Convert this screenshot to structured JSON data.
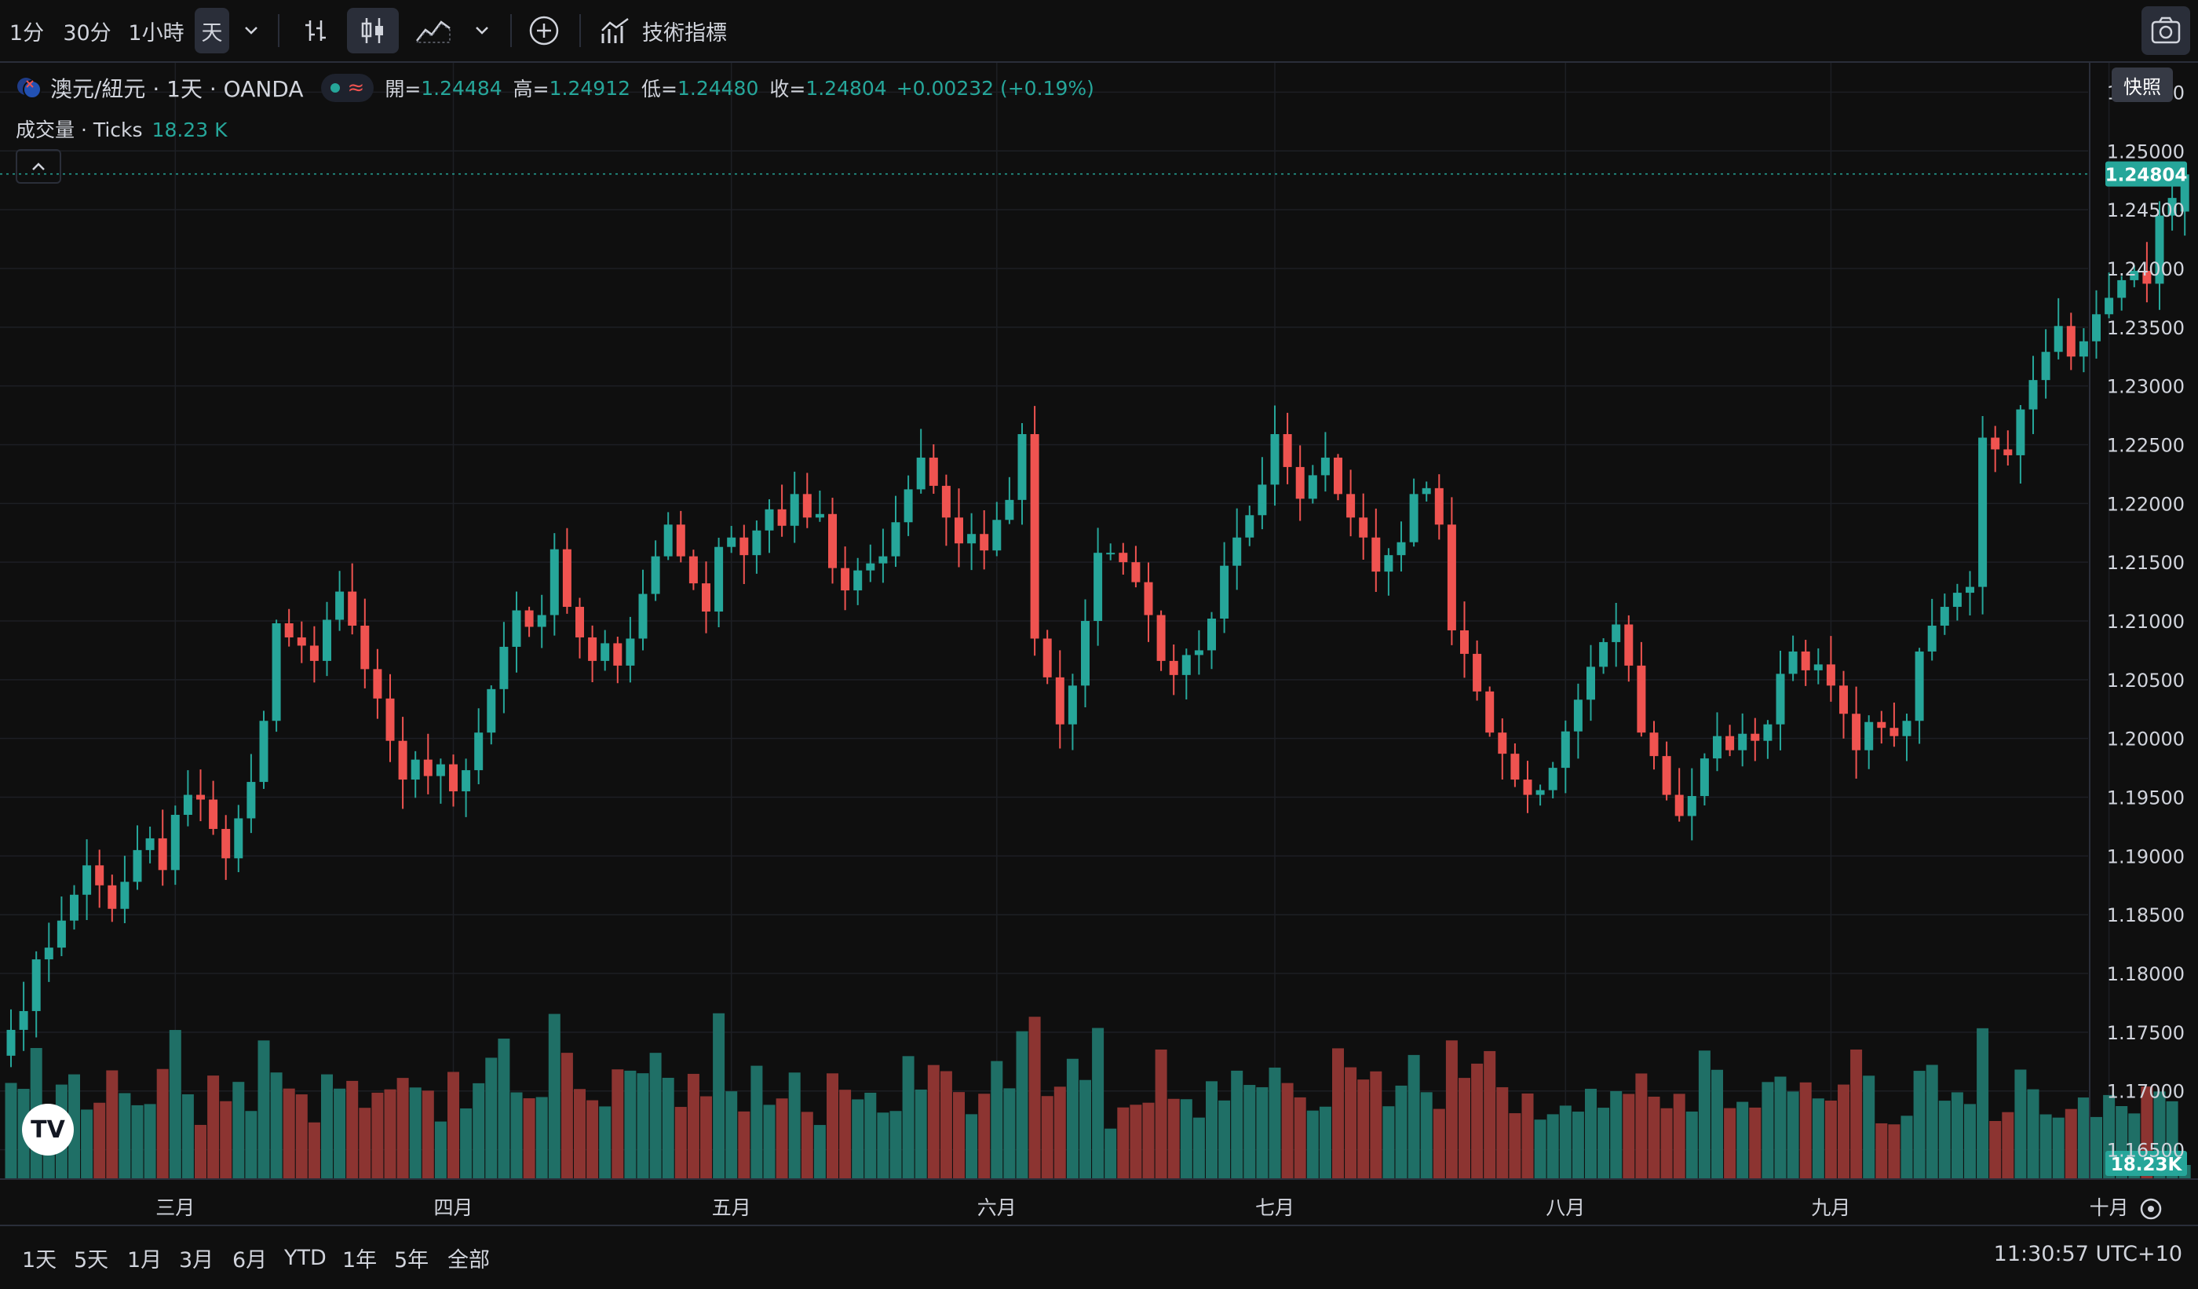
{
  "toolbar": {
    "intervals": [
      "1分",
      "30分",
      "1小時",
      "天"
    ],
    "active_interval": "天",
    "indicators_label": "技術指標",
    "snapshot_tooltip": "快照"
  },
  "legend": {
    "symbol": "澳元/紐元 · 1天 · OANDA",
    "open_label": "開=",
    "open": "1.24484",
    "high_label": "高=",
    "high": "1.24912",
    "low_label": "低=",
    "low": "1.24480",
    "close_label": "收=",
    "close": "1.24804",
    "change": "+0.00232 (+0.19%)",
    "volume_label": "成交量 · Ticks",
    "volume_value": "18.23 K"
  },
  "bottom": {
    "ranges": [
      "1天",
      "5天",
      "1月",
      "3月",
      "6月",
      "YTD",
      "1年",
      "5年",
      "全部"
    ],
    "clock": "11:30:57 UTC+10"
  },
  "chart_data": {
    "type": "candlestick",
    "title": "澳元/紐元 · 1天 · OANDA",
    "colors": {
      "up": "#26a69a",
      "down": "#ef5350",
      "vol_up": "#1f6f66",
      "vol_down": "#8c3431",
      "last_price_bg": "#26a69a"
    },
    "y_axis": {
      "min": 1.1625,
      "max": 1.2575,
      "ticks": [
        "1.16500",
        "1.17000",
        "1.17500",
        "1.18000",
        "1.18500",
        "1.19000",
        "1.19500",
        "1.20000",
        "1.20500",
        "1.21000",
        "1.21500",
        "1.22000",
        "1.22500",
        "1.23000",
        "1.23500",
        "1.24000",
        "1.24500",
        "1.25000",
        "1.25500"
      ]
    },
    "x_axis": {
      "month_labels": [
        {
          "label": "三月",
          "bar": 13
        },
        {
          "label": "四月",
          "bar": 35
        },
        {
          "label": "五月",
          "bar": 57
        },
        {
          "label": "六月",
          "bar": 78
        },
        {
          "label": "七月",
          "bar": 100
        },
        {
          "label": "八月",
          "bar": 123
        },
        {
          "label": "九月",
          "bar": 144
        },
        {
          "label": "十月",
          "bar": 166
        }
      ]
    },
    "last_price": "1.24804",
    "last_volume": "18.23K",
    "close": [
      1.1752,
      1.1768,
      1.1812,
      1.1822,
      1.1845,
      1.1867,
      1.1892,
      1.1875,
      1.1855,
      1.1878,
      1.1905,
      1.1915,
      1.1888,
      1.1935,
      1.1952,
      1.1948,
      1.1923,
      1.1898,
      1.1932,
      1.1963,
      1.2015,
      1.2098,
      1.2086,
      1.2079,
      1.2066,
      1.2101,
      1.2125,
      1.2096,
      1.2059,
      1.2034,
      1.1998,
      1.1965,
      1.1982,
      1.1968,
      1.1978,
      1.1955,
      1.1973,
      1.2005,
      1.2042,
      1.2078,
      1.2109,
      1.2095,
      1.2105,
      1.2161,
      1.2112,
      1.2086,
      1.2066,
      1.2081,
      1.2062,
      1.2085,
      1.2123,
      1.2155,
      1.2182,
      1.2155,
      1.2132,
      1.2108,
      1.2163,
      1.2171,
      1.2156,
      1.2177,
      1.2195,
      1.2181,
      1.2208,
      1.2188,
      1.2191,
      1.2145,
      1.2126,
      1.2143,
      1.2149,
      1.2155,
      1.2184,
      1.2212,
      1.2239,
      1.2215,
      1.2188,
      1.2166,
      1.2174,
      1.216,
      1.2186,
      1.2203,
      1.2259,
      1.2085,
      1.2052,
      1.2012,
      1.2045,
      1.21,
      1.2158,
      1.2158,
      1.215,
      1.2133,
      1.2105,
      1.2066,
      1.2054,
      1.2071,
      1.2075,
      1.2102,
      1.2147,
      1.2171,
      1.219,
      1.2216,
      1.2259,
      1.2231,
      1.2204,
      1.2224,
      1.2239,
      1.2208,
      1.2188,
      1.2171,
      1.2142,
      1.2156,
      1.2167,
      1.2208,
      1.2213,
      1.2182,
      1.2092,
      1.2072,
      1.204,
      1.2005,
      1.1987,
      1.1965,
      1.1952,
      1.1956,
      1.1975,
      1.2006,
      1.2033,
      1.2061,
      1.2082,
      1.2097,
      1.2062,
      1.2005,
      1.1985,
      1.1952,
      1.1934,
      1.1951,
      1.1983,
      1.2002,
      1.199,
      1.2004,
      1.1998,
      1.2012,
      1.2055,
      1.2074,
      1.2058,
      1.2063,
      1.2045,
      1.2021,
      1.199,
      1.2014,
      1.2009,
      1.2002,
      1.2015,
      1.2074,
      1.2096,
      1.2112,
      1.2124,
      1.2129,
      1.2256,
      1.2246,
      1.2241,
      1.228,
      1.2305,
      1.2329,
      1.2351,
      1.2325,
      1.2338,
      1.2361,
      1.2375,
      1.239,
      1.2398,
      1.2387,
      1.2445,
      1.246,
      1.248
    ]
  }
}
